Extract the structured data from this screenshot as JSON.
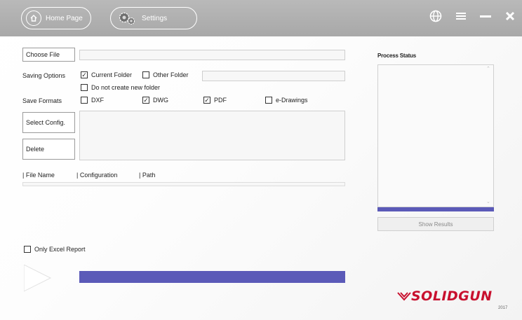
{
  "header": {
    "home_label": "Home Page",
    "settings_label": "Settings",
    "icons": [
      "globe-icon",
      "menu-icon",
      "minimize-icon",
      "close-icon"
    ]
  },
  "main": {
    "choose_file_label": "Choose File",
    "file_path_value": "",
    "saving_options_label": "Saving Options",
    "current_folder_label": "Current Folder",
    "current_folder_checked": true,
    "other_folder_label": "Other Folder",
    "other_folder_checked": false,
    "other_folder_value": "",
    "no_new_folder_label": "Do not create new folder",
    "no_new_folder_checked": false,
    "save_formats_label": "Save Formats",
    "formats": [
      {
        "label": "DXF",
        "checked": false
      },
      {
        "label": "DWG",
        "checked": true
      },
      {
        "label": "PDF",
        "checked": true
      },
      {
        "label": "e-Drawings",
        "checked": false
      }
    ],
    "select_config_label": "Select Config.",
    "delete_label": "Delete",
    "columns": [
      "| File Name",
      "| Configuration",
      "| Path"
    ],
    "only_excel_label": "Only Excel Report",
    "only_excel_checked": false
  },
  "status": {
    "title": "Process Status",
    "show_results_label": "Show Results"
  },
  "branding": {
    "logo_text": "SOLIDGUN",
    "year": "2017",
    "logo_color": "#c8102e"
  },
  "colors": {
    "header": "#b3b3b3",
    "progress": "#5b5ab8"
  }
}
